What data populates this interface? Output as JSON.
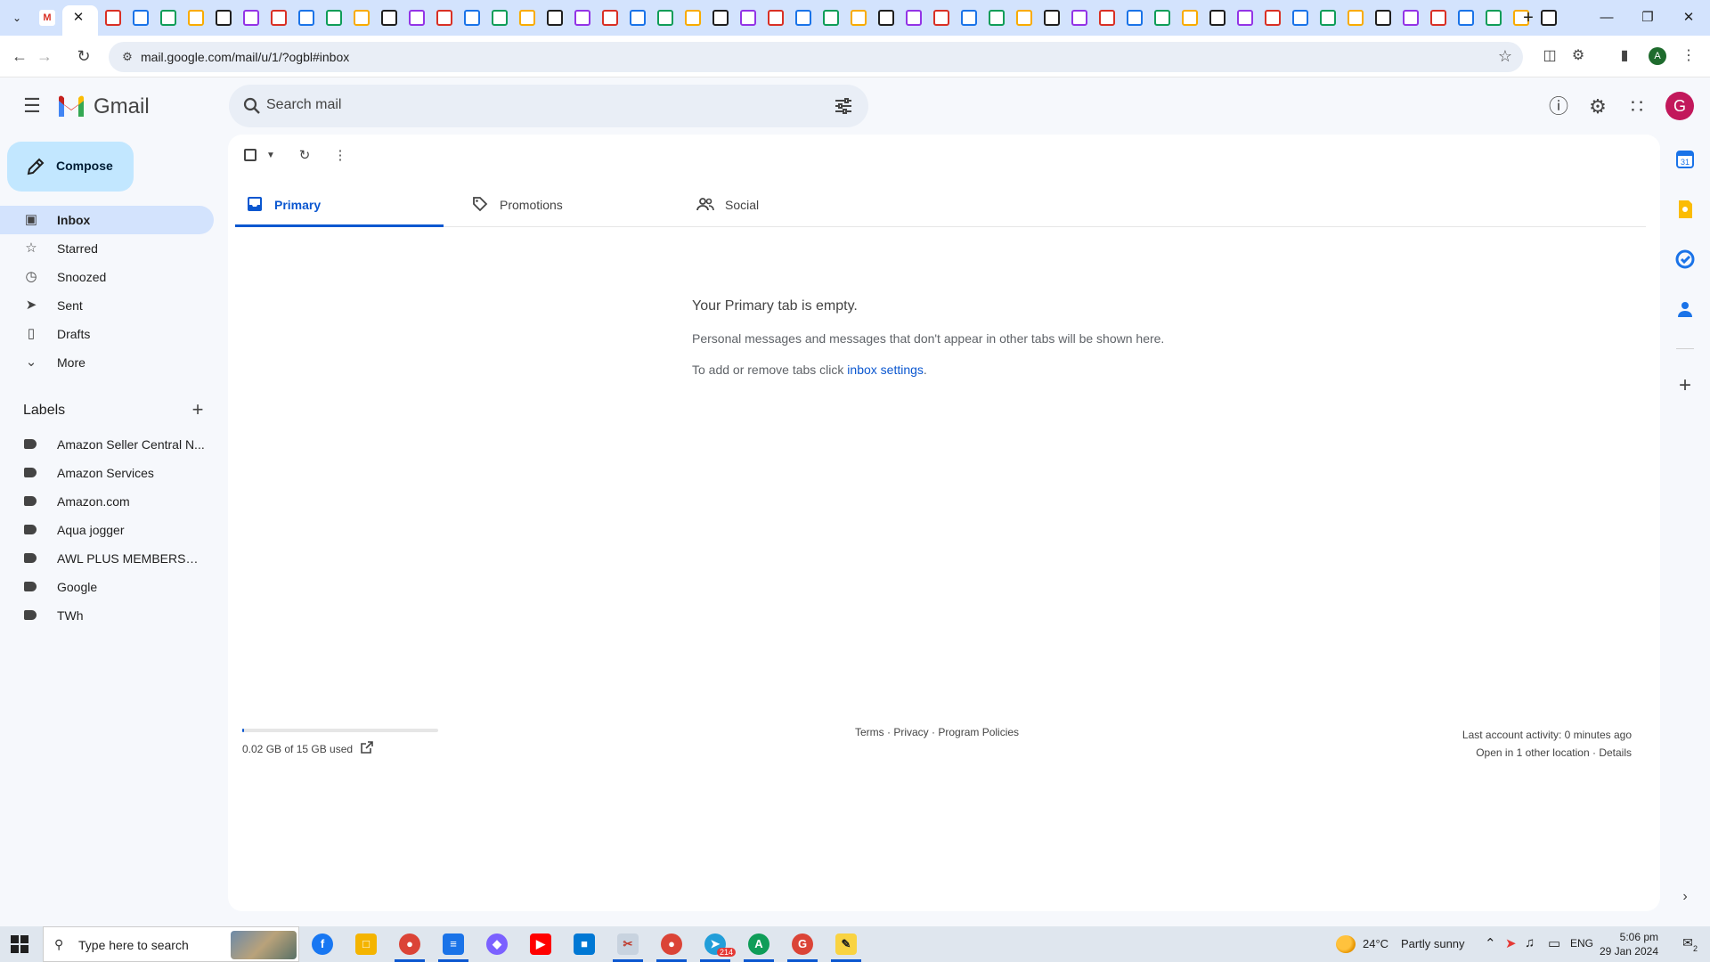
{
  "browser": {
    "tab_strip_colors": [
      "#d93025",
      "#1a73e8",
      "#0f9d58",
      "#f9ab00",
      "#1f1f1f",
      "#9334e6"
    ],
    "address_url": "mail.google.com/mail/u/1/?ogbl#inbox",
    "profile_initial": "A"
  },
  "header": {
    "app_name": "Gmail",
    "search_placeholder": "Search mail",
    "avatar_initial": "G"
  },
  "sidebar": {
    "compose_label": "Compose",
    "nav_items": [
      {
        "label": "Inbox",
        "icon": "inbox-icon",
        "active": true
      },
      {
        "label": "Starred",
        "icon": "star-icon"
      },
      {
        "label": "Snoozed",
        "icon": "clock-icon"
      },
      {
        "label": "Sent",
        "icon": "send-icon"
      },
      {
        "label": "Drafts",
        "icon": "draft-icon"
      },
      {
        "label": "More",
        "icon": "chevron-down-icon"
      }
    ],
    "labels_heading": "Labels",
    "labels": [
      "Amazon Seller Central N...",
      "Amazon Services",
      "Amazon.com",
      "Aqua jogger",
      "AWL PLUS MEMBERSHIP",
      "Google",
      "TWh"
    ]
  },
  "main": {
    "tabs": [
      {
        "label": "Primary",
        "icon": "inbox-icon",
        "active": true
      },
      {
        "label": "Promotions",
        "icon": "tag-icon"
      },
      {
        "label": "Social",
        "icon": "people-icon"
      }
    ],
    "empty_title": "Your Primary tab is empty.",
    "empty_description": "Personal messages and messages that don't appear in other tabs will be shown here.",
    "empty_settings_prefix": "To add or remove tabs click ",
    "empty_settings_link": "inbox settings",
    "empty_settings_suffix": ".",
    "storage_used_text": "0.02 GB of 15 GB used",
    "storage_fraction": 0.0013,
    "footer_links": {
      "terms": "Terms",
      "privacy": "Privacy",
      "policies": "Program Policies",
      "sep": " · "
    },
    "last_activity": "Last account activity: 0 minutes ago",
    "other_location": "Open in 1 other location",
    "details": "Details"
  },
  "taskbar": {
    "search_placeholder": "Type here to search",
    "weather_temp": "24°C",
    "weather_desc": "Partly sunny",
    "language": "ENG",
    "time": "5:06 pm",
    "date": "29 Jan 2024",
    "telegram_badge": "214",
    "notification_count": "2"
  },
  "colors": {
    "accent": "#0b57d0",
    "compose_bg": "#c2e7ff",
    "active_nav_bg": "#d3e3fd",
    "page_bg": "#f6f8fc"
  }
}
